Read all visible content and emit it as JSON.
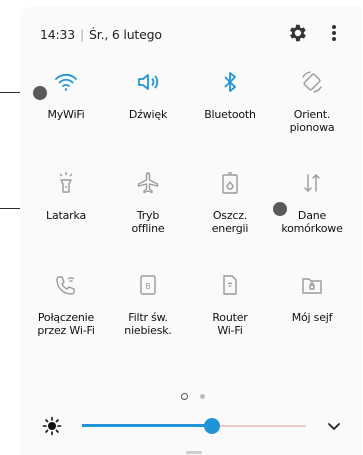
{
  "status": {
    "time": "14:33",
    "separator": "|",
    "date": "Śr., 6 lutego"
  },
  "tiles": [
    {
      "label": "MyWiFi",
      "icon": "wifi-icon",
      "active": true
    },
    {
      "label": "Dźwięk",
      "icon": "speaker-icon",
      "active": true
    },
    {
      "label": "Bluetooth",
      "icon": "bluetooth-icon",
      "active": true
    },
    {
      "label": "Orient.\npionowa",
      "icon": "rotation-lock-icon",
      "active": false
    },
    {
      "label": "Latarka",
      "icon": "flashlight-icon",
      "active": false
    },
    {
      "label": "Tryb\noffline",
      "icon": "airplane-icon",
      "active": false
    },
    {
      "label": "Oszcz.\nenergii",
      "icon": "battery-saver-icon",
      "active": false
    },
    {
      "label": "Dane\nkomórkowe",
      "icon": "mobile-data-icon",
      "active": false
    },
    {
      "label": "Połączenie\nprzez Wi-Fi",
      "icon": "wifi-calling-icon",
      "active": false
    },
    {
      "label": "Filtr św.\nniebiesk.",
      "icon": "blue-light-filter-icon",
      "active": false
    },
    {
      "label": "Router\nWi-Fi",
      "icon": "hotspot-icon",
      "active": false
    },
    {
      "label": "Mój sejf",
      "icon": "secure-folder-icon",
      "active": false
    }
  ],
  "brightness": {
    "level": 0.58
  },
  "pager": {
    "pages": 2,
    "current": 1
  },
  "colors": {
    "active": "#1f94d8",
    "inactive": "#9a9a9a",
    "text": "#111111"
  }
}
